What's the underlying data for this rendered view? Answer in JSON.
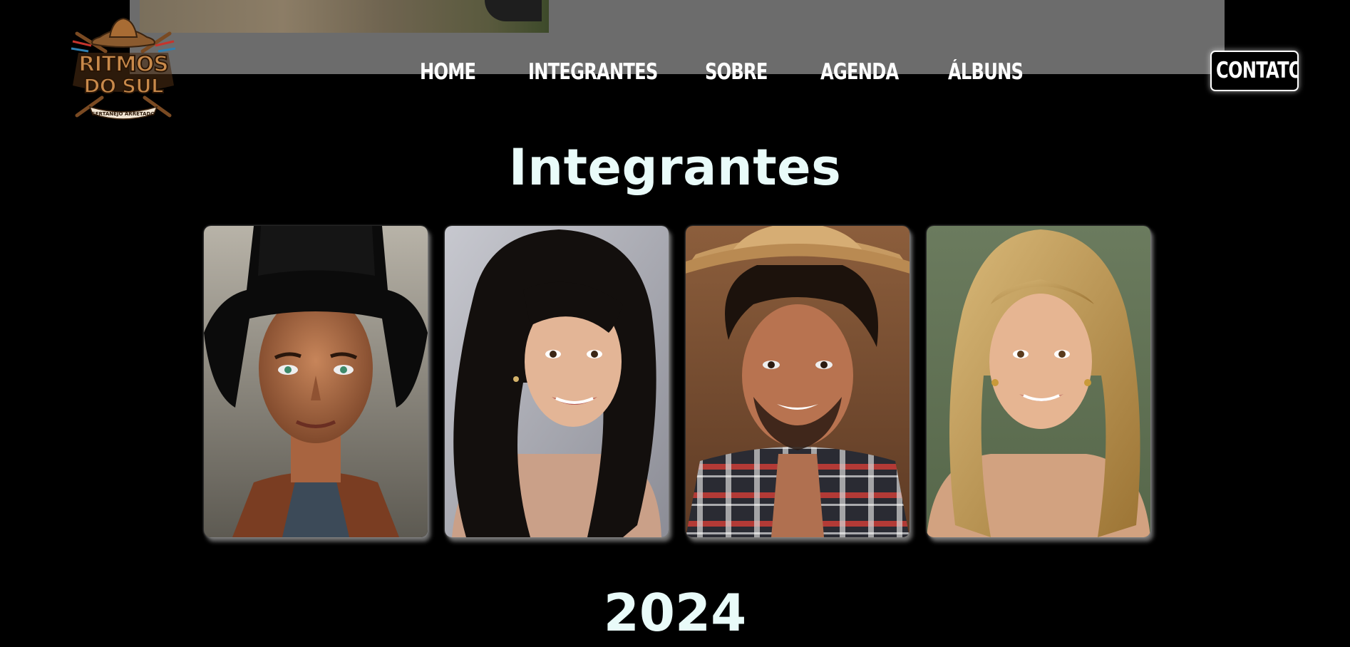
{
  "logo": {
    "line1": "RITMOS",
    "line2": "DO SUL",
    "tagline": "SERTANEJO ARRETADO",
    "icon": "cowboy-hat-guitar-logo"
  },
  "nav": {
    "items": [
      {
        "label": "HOME"
      },
      {
        "label": "INTEGRANTES"
      },
      {
        "label": "SOBRE"
      },
      {
        "label": "AGENDA"
      },
      {
        "label": "ÁLBUNS"
      }
    ],
    "contact_label": "CONTATO"
  },
  "members_section": {
    "title": "Integrantes",
    "members": [
      {
        "photo": "man-black-cowboy-hat-portrait"
      },
      {
        "photo": "woman-dark-curly-hair-portrait"
      },
      {
        "photo": "man-straw-hat-plaid-shirt-portrait"
      },
      {
        "photo": "woman-blonde-hair-portrait"
      }
    ]
  },
  "next_section": {
    "title": "2024"
  },
  "colors": {
    "background": "#000000",
    "heading": "#e9fbf9",
    "nav_text": "#ffffff",
    "hero_overlay": "#6c6c6c",
    "logo_brown": "#a0622d"
  }
}
